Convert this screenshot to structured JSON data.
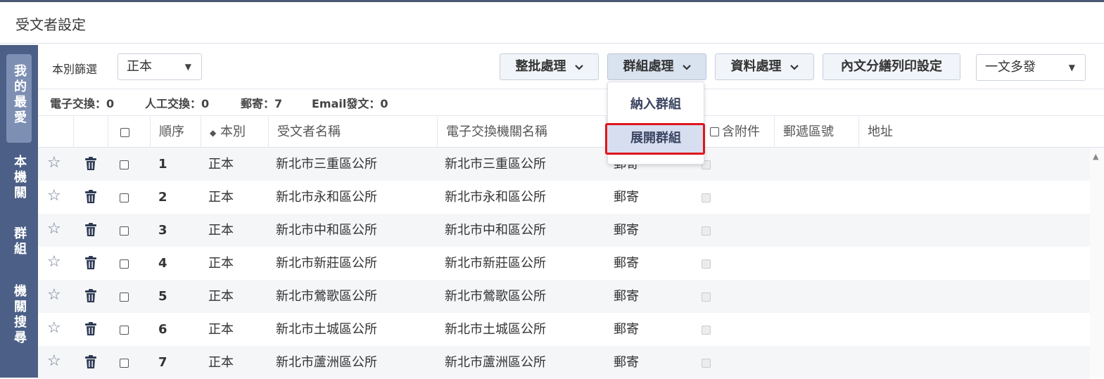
{
  "page": {
    "title": "受文者設定"
  },
  "sidenav": {
    "tabs": [
      "我的最愛",
      "本機關",
      "群組",
      "機關搜尋"
    ]
  },
  "toolbar": {
    "filter_label": "本別篩選",
    "filter_value": "正本",
    "batch_btn": "整批處理",
    "group_btn": "群組處理",
    "data_btn": "資料處理",
    "print_btn": "內文分繕列印設定",
    "mode_value": "一文多發"
  },
  "counts": {
    "electronic": "電子交換：0",
    "manual": "人工交換：0",
    "mail": "郵寄：7",
    "email": "Email發文：0"
  },
  "group_menu": {
    "items": [
      "納入群組",
      "展開群組"
    ],
    "highlighted_index": 1
  },
  "table": {
    "headers": {
      "order": "順序",
      "type": "本別",
      "name": "受文者名稱",
      "agency": "電子交換機關名稱",
      "attach": "含附件",
      "zip": "郵遞區號",
      "address": "地址"
    },
    "rows": [
      {
        "order": "1",
        "type": "正本",
        "name": "新北市三重區公所",
        "agency": "新北市三重區公所",
        "method": "郵寄"
      },
      {
        "order": "2",
        "type": "正本",
        "name": "新北市永和區公所",
        "agency": "新北市永和區公所",
        "method": "郵寄"
      },
      {
        "order": "3",
        "type": "正本",
        "name": "新北市中和區公所",
        "agency": "新北市中和區公所",
        "method": "郵寄"
      },
      {
        "order": "4",
        "type": "正本",
        "name": "新北市新莊區公所",
        "agency": "新北市新莊區公所",
        "method": "郵寄"
      },
      {
        "order": "5",
        "type": "正本",
        "name": "新北市鶯歌區公所",
        "agency": "新北市鶯歌區公所",
        "method": "郵寄"
      },
      {
        "order": "6",
        "type": "正本",
        "name": "新北市土城區公所",
        "agency": "新北市土城區公所",
        "method": "郵寄"
      },
      {
        "order": "7",
        "type": "正本",
        "name": "新北市蘆洲區公所",
        "agency": "新北市蘆洲區公所",
        "method": "郵寄"
      }
    ]
  },
  "icons": {
    "star": "star-outline-icon",
    "trash": "trash-icon",
    "sort": "sort-icon",
    "caret": "caret-down-icon",
    "chevron": "chevron-down-icon"
  },
  "colors": {
    "sidenav": "#4c5f87",
    "highlight_border": "#e0151c",
    "menu_highlight": "#d6deef"
  }
}
